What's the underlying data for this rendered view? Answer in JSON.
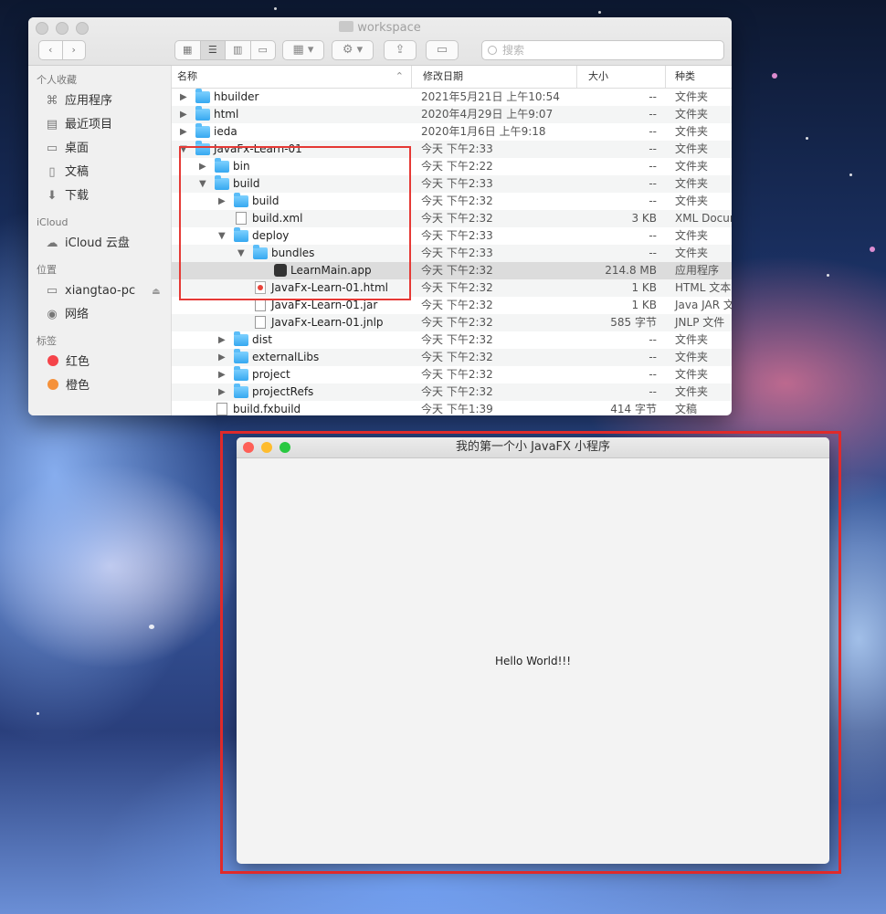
{
  "finder": {
    "title": "workspace",
    "search_placeholder": "搜索",
    "sidebar": {
      "favorites_header": "个人收藏",
      "favorites": [
        {
          "label": "应用程序",
          "icon": "applications-icon"
        },
        {
          "label": "最近项目",
          "icon": "recents-icon"
        },
        {
          "label": "桌面",
          "icon": "desktop-icon"
        },
        {
          "label": "文稿",
          "icon": "documents-icon"
        },
        {
          "label": "下载",
          "icon": "downloads-icon"
        }
      ],
      "icloud_header": "iCloud",
      "icloud": [
        {
          "label": "iCloud 云盘",
          "icon": "icloud-icon"
        }
      ],
      "locations_header": "位置",
      "locations": [
        {
          "label": "xiangtao-pc",
          "icon": "computer-icon"
        },
        {
          "label": "网络",
          "icon": "network-icon"
        }
      ],
      "tags_header": "标签",
      "tags": [
        {
          "label": "红色",
          "color": "#f5444a"
        },
        {
          "label": "橙色",
          "color": "#f5913a"
        }
      ]
    },
    "columns": {
      "name": "名称",
      "date": "修改日期",
      "size": "大小",
      "kind": "种类"
    },
    "rows": [
      {
        "name": "hbuilder",
        "date": "2021年5月21日 上午10:54",
        "size": "--",
        "kind": "文件夹",
        "type": "folder",
        "depth": 0,
        "tri": "closed"
      },
      {
        "name": "html",
        "date": "2020年4月29日 上午9:07",
        "size": "--",
        "kind": "文件夹",
        "type": "folder",
        "depth": 0,
        "tri": "closed"
      },
      {
        "name": "ieda",
        "date": "2020年1月6日 上午9:18",
        "size": "--",
        "kind": "文件夹",
        "type": "folder",
        "depth": 0,
        "tri": "closed"
      },
      {
        "name": "JavaFx-Learn-01",
        "date": "今天 下午2:33",
        "size": "--",
        "kind": "文件夹",
        "type": "folder",
        "depth": 0,
        "tri": "open"
      },
      {
        "name": "bin",
        "date": "今天 下午2:22",
        "size": "--",
        "kind": "文件夹",
        "type": "folder",
        "depth": 1,
        "tri": "closed"
      },
      {
        "name": "build",
        "date": "今天 下午2:33",
        "size": "--",
        "kind": "文件夹",
        "type": "folder",
        "depth": 1,
        "tri": "open"
      },
      {
        "name": "build",
        "date": "今天 下午2:32",
        "size": "--",
        "kind": "文件夹",
        "type": "folder",
        "depth": 2,
        "tri": "closed"
      },
      {
        "name": "build.xml",
        "date": "今天 下午2:32",
        "size": "3 KB",
        "kind": "XML Docume",
        "type": "file",
        "depth": 2,
        "tri": "none"
      },
      {
        "name": "deploy",
        "date": "今天 下午2:33",
        "size": "--",
        "kind": "文件夹",
        "type": "folder",
        "depth": 2,
        "tri": "open"
      },
      {
        "name": "bundles",
        "date": "今天 下午2:33",
        "size": "--",
        "kind": "文件夹",
        "type": "folder",
        "depth": 3,
        "tri": "open"
      },
      {
        "name": "LearnMain.app",
        "date": "今天 下午2:32",
        "size": "214.8 MB",
        "kind": "应用程序",
        "type": "app",
        "depth": 4,
        "tri": "none",
        "selected": true
      },
      {
        "name": "JavaFx-Learn-01.html",
        "date": "今天 下午2:32",
        "size": "1 KB",
        "kind": "HTML 文本",
        "type": "html",
        "depth": 3,
        "tri": "none"
      },
      {
        "name": "JavaFx-Learn-01.jar",
        "date": "今天 下午2:32",
        "size": "1 KB",
        "kind": "Java JAR 文",
        "type": "file",
        "depth": 3,
        "tri": "none"
      },
      {
        "name": "JavaFx-Learn-01.jnlp",
        "date": "今天 下午2:32",
        "size": "585 字节",
        "kind": "JNLP 文件",
        "type": "file",
        "depth": 3,
        "tri": "none"
      },
      {
        "name": "dist",
        "date": "今天 下午2:32",
        "size": "--",
        "kind": "文件夹",
        "type": "folder",
        "depth": 2,
        "tri": "closed"
      },
      {
        "name": "externalLibs",
        "date": "今天 下午2:32",
        "size": "--",
        "kind": "文件夹",
        "type": "folder",
        "depth": 2,
        "tri": "closed"
      },
      {
        "name": "project",
        "date": "今天 下午2:32",
        "size": "--",
        "kind": "文件夹",
        "type": "folder",
        "depth": 2,
        "tri": "closed"
      },
      {
        "name": "projectRefs",
        "date": "今天 下午2:32",
        "size": "--",
        "kind": "文件夹",
        "type": "folder",
        "depth": 2,
        "tri": "closed"
      },
      {
        "name": "build.fxbuild",
        "date": "今天 下午1:39",
        "size": "414 字节",
        "kind": "文稿",
        "type": "file",
        "depth": 1,
        "tri": "none"
      }
    ]
  },
  "fxwindow": {
    "title": "我的第一个小 JavaFX 小程序",
    "content": "Hello World!!!",
    "lights": [
      "#fe5f57",
      "#febc2e",
      "#28c840"
    ]
  },
  "colors": {
    "annotation": "#e02a2a",
    "folder": "#36a8f0"
  }
}
